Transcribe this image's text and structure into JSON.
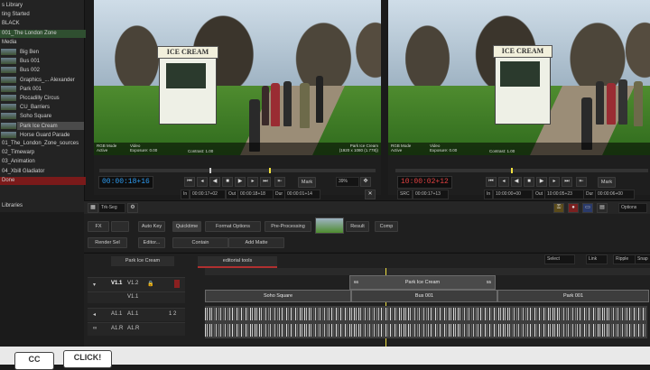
{
  "library": {
    "items": [
      {
        "label": "s Library",
        "style": "plain"
      },
      {
        "label": "ting Started",
        "style": "plain"
      },
      {
        "label": "BLACK",
        "style": "plain"
      },
      {
        "label": "001_The London Zone",
        "style": "green"
      },
      {
        "label": "Media",
        "style": "plain"
      },
      {
        "label": "Big Ben",
        "style": "thumb"
      },
      {
        "label": "Bus 001",
        "style": "thumb"
      },
      {
        "label": "Bus 002",
        "style": "thumb"
      },
      {
        "label": "Graphics_... Alexander",
        "style": "thumb"
      },
      {
        "label": "Park 001",
        "style": "thumb"
      },
      {
        "label": "Piccadilly Circus",
        "style": "thumb"
      },
      {
        "label": "CU_Barriers",
        "style": "thumb"
      },
      {
        "label": "Soho Square",
        "style": "thumb"
      },
      {
        "label": "Park Ice Cream",
        "style": "sel"
      },
      {
        "label": "Horse Guard Parade",
        "style": "thumb"
      },
      {
        "label": "01_The_London_Zone_sources",
        "style": "plain"
      },
      {
        "label": "02_Timewarp",
        "style": "plain"
      },
      {
        "label": "03_Animation",
        "style": "plain"
      },
      {
        "label": "04_Xbill Gladiator",
        "style": "plain"
      },
      {
        "label": "Done",
        "style": "red"
      }
    ],
    "footer": "Libraries"
  },
  "source_viewer": {
    "sign": "ICE CREAM",
    "info_left": "RGB Mode\nActive",
    "info_video": "Video\nExposure: 0.00",
    "info_contrast": "Contrast: 1.00",
    "info_right": "Park Ice Cream\n(1920 x 1080 (1.778))"
  },
  "record_viewer": {
    "sign": "ICE CREAM",
    "info_left": "RGB Mode\nActive",
    "info_video": "Video\nExposure: 0.00",
    "info_contrast": "Contrast: 1.00"
  },
  "source_controls": {
    "timecode": "00:00:18+16",
    "in_label": "In",
    "in_value": "00:00:17+02",
    "out_label": "Out",
    "out_value": "00:00:18+18",
    "dur_label": "Dur",
    "dur_value": "00:00:01+14",
    "mark": "Mark",
    "zoom": "39%"
  },
  "record_controls": {
    "timecode": "10:00:02+12",
    "src_label": "SRC",
    "src_value": "00:00:17+13",
    "in_label": "In",
    "in_value": "10:00:00+00",
    "out_label": "Out",
    "out_value": "10:00:05+23",
    "dur_label": "Dur",
    "dur_value": "00:00:06+00",
    "mark": "Mark"
  },
  "toolbar": {
    "trk_seg": "Trk-Seg",
    "options": "Options"
  },
  "edit_panel": {
    "fx": "FX",
    "auto_key": "Auto Key",
    "quicktime": "Quicktime",
    "format_options": "Format Options",
    "pre_processing": "Pre-Processing",
    "result": "Result",
    "comp": "Comp",
    "render_sel": "Render Sel",
    "editor": "Editor...",
    "contain": "Contain",
    "add_matte": "Add Matte"
  },
  "timeline": {
    "tab_clip": "Park Ice Cream",
    "tab_tools": "editorial tools",
    "select": "Select",
    "link": "Link",
    "ripple": "Ripple",
    "snap": "Snap",
    "tracks": [
      {
        "name": "V1.1",
        "sub": "V1.2"
      },
      {
        "name": "V1.1",
        "sub": ""
      },
      {
        "name": "A1.1",
        "sub": "A1.1"
      },
      {
        "name": "A1.R",
        "sub": "A1.R"
      }
    ],
    "clip_top": {
      "label": "Park Ice Cream",
      "in_num": "66",
      "out_num": "55"
    },
    "clips": [
      {
        "label": "Soho Square"
      },
      {
        "label": "Bus 001"
      },
      {
        "label": "Park 001"
      }
    ],
    "ruler_label": "1 2"
  },
  "caption": {
    "badge1": "CC",
    "badge2": "CLICK!"
  }
}
